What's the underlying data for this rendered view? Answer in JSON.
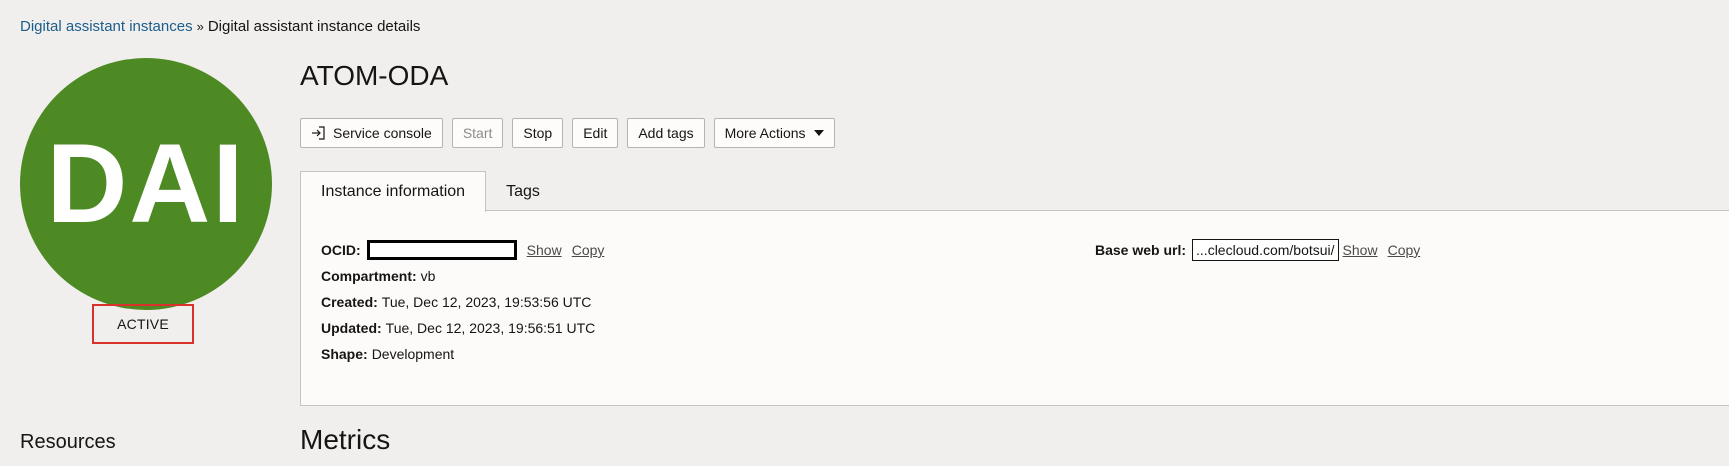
{
  "breadcrumb": {
    "parent": "Digital assistant instances",
    "separator": "»",
    "current": "Digital assistant instance details"
  },
  "avatar": {
    "initials": "DAI",
    "color": "#4e8a24"
  },
  "status": {
    "text": "ACTIVE",
    "highlight_color": "#d9312b"
  },
  "sidebar": {
    "resources_heading": "Resources"
  },
  "page": {
    "title": "ATOM-ODA"
  },
  "toolbar": {
    "service_console": "Service console",
    "service_console_icon": "external-link-icon",
    "start": "Start",
    "stop": "Stop",
    "edit": "Edit",
    "add_tags": "Add tags",
    "more_actions": "More Actions"
  },
  "tabs": [
    {
      "label": "Instance information",
      "active": true
    },
    {
      "label": "Tags",
      "active": false
    }
  ],
  "instance_info": {
    "ocid": {
      "label": "OCID:",
      "show": "Show",
      "copy": "Copy"
    },
    "compartment": {
      "label": "Compartment:",
      "value": "vb"
    },
    "created": {
      "label": "Created:",
      "value": "Tue, Dec 12, 2023, 19:53:56 UTC"
    },
    "updated": {
      "label": "Updated:",
      "value": "Tue, Dec 12, 2023, 19:56:51 UTC"
    },
    "shape": {
      "label": "Shape:",
      "value": "Development"
    },
    "base_web_url": {
      "label": "Base web url:",
      "value": "...clecloud.com/botsui/",
      "show": "Show",
      "copy": "Copy"
    }
  },
  "metrics": {
    "heading": "Metrics"
  }
}
